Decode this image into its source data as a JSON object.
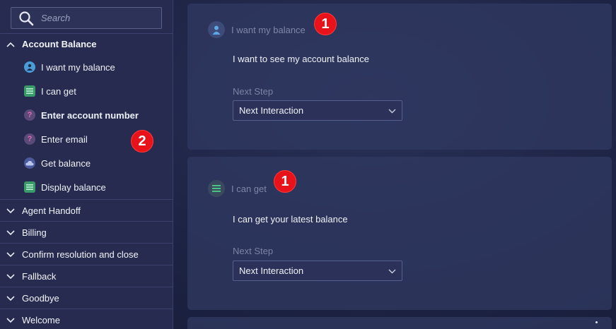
{
  "search": {
    "placeholder": "Search"
  },
  "sidebar": {
    "expanded_group": "Account Balance",
    "items": [
      {
        "label": "I want my balance",
        "icon": "user-icon"
      },
      {
        "label": "I can get",
        "icon": "list-icon"
      },
      {
        "label": "Enter account number",
        "icon": "question-icon"
      },
      {
        "label": "Enter email",
        "icon": "question-icon"
      },
      {
        "label": "Get balance",
        "icon": "cloud-icon"
      },
      {
        "label": "Display balance",
        "icon": "list-icon"
      }
    ],
    "groups": [
      "Agent Handoff",
      "Billing",
      "Confirm resolution and close",
      "Fallback",
      "Goodbye",
      "Welcome"
    ]
  },
  "badges": {
    "one": "1",
    "two": "2"
  },
  "cards": [
    {
      "title": "I want my balance",
      "message": "I want to see my account balance",
      "next_step_label": "Next Step",
      "next_step_value": "Next Interaction"
    },
    {
      "title": "I can get",
      "message": "I can get your latest balance",
      "next_step_label": "Next Step",
      "next_step_value": "Next Interaction"
    }
  ],
  "colors": {
    "badge": "#e8131a",
    "sidebar": "#262b4f",
    "card": "#303860"
  }
}
